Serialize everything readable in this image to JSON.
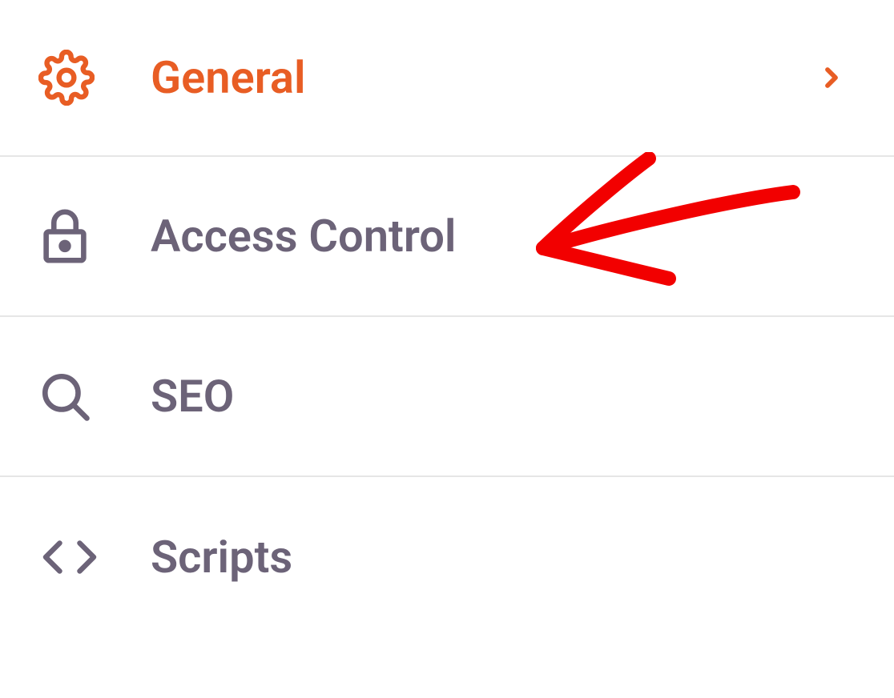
{
  "menu": {
    "items": [
      {
        "label": "General",
        "icon": "gear-icon",
        "active": true,
        "has_chevron": true
      },
      {
        "label": "Access Control",
        "icon": "lock-icon",
        "active": false,
        "has_chevron": false,
        "annotated": true
      },
      {
        "label": "SEO",
        "icon": "search-icon",
        "active": false,
        "has_chevron": false
      },
      {
        "label": "Scripts",
        "icon": "code-icon",
        "active": false,
        "has_chevron": false
      }
    ]
  },
  "colors": {
    "active": "#e85d24",
    "inactive": "#6c6378",
    "annotation": "#f20000",
    "divider": "#e6e6e6"
  }
}
